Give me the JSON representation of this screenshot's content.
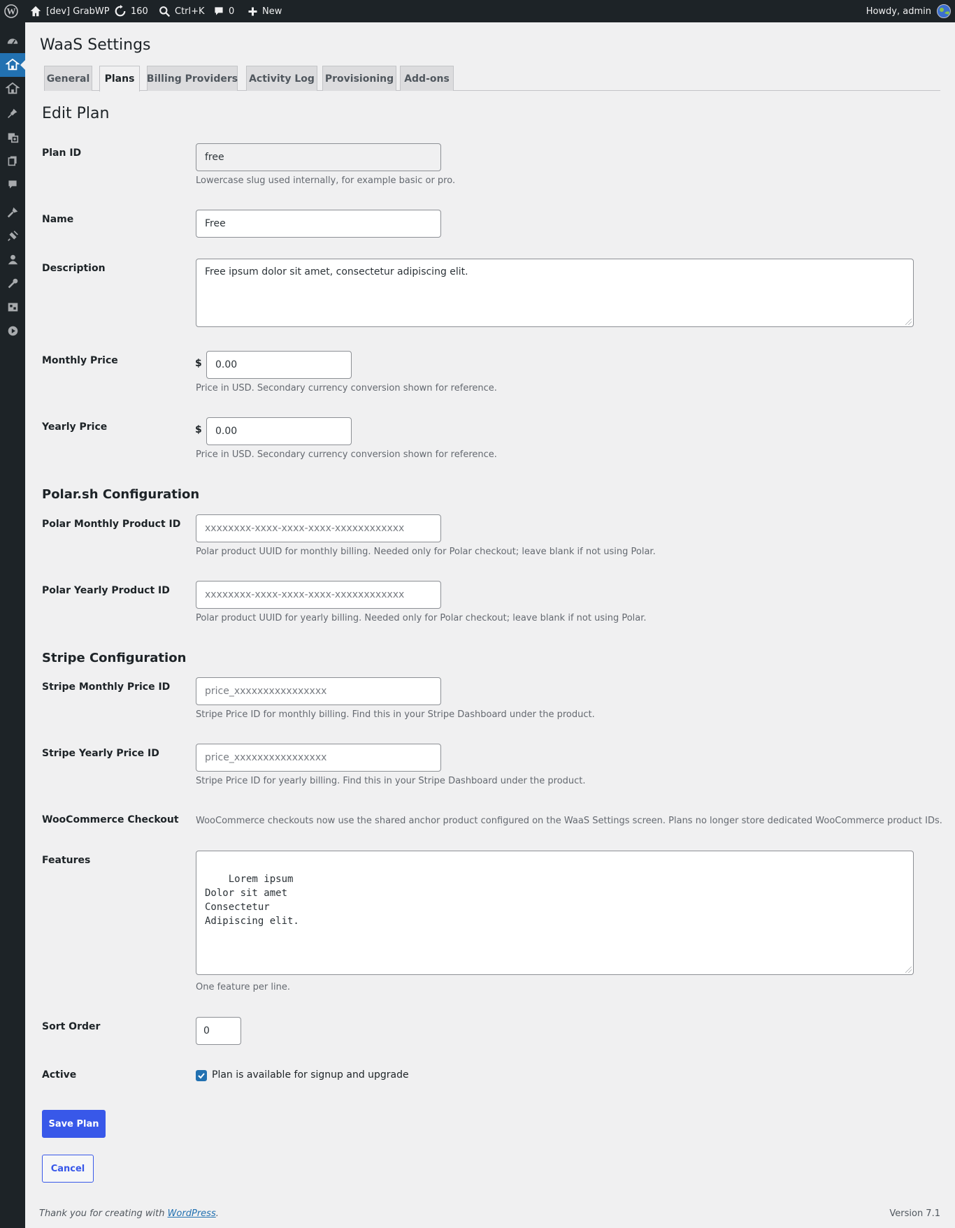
{
  "adminbar": {
    "site_name": "[dev] GrabWP",
    "updates_count": "160",
    "search_shortcut": "Ctrl+K",
    "comments_count": "0",
    "new_label": "New",
    "greeting": "Howdy, admin"
  },
  "sidemenu": {
    "icons": [
      "dashboard-icon",
      "waas-icon",
      "sites-icon",
      "posts-icon",
      "media-icon",
      "pages-icon",
      "comments-icon",
      "appearance-icon",
      "plugins-icon",
      "users-icon",
      "tools-icon",
      "settings-icon",
      "player-icon"
    ]
  },
  "page": {
    "title": "WaaS Settings",
    "tabs": [
      {
        "label": "General",
        "active": false
      },
      {
        "label": "Plans",
        "active": true
      },
      {
        "label": "Billing Providers",
        "active": false
      },
      {
        "label": "Activity Log",
        "active": false
      },
      {
        "label": "Provisioning",
        "active": false
      },
      {
        "label": "Add-ons",
        "active": false
      }
    ],
    "heading": "Edit Plan"
  },
  "form": {
    "plan_id": {
      "label": "Plan ID",
      "value": "free",
      "help": "Lowercase slug used internally, for example basic or pro."
    },
    "name": {
      "label": "Name",
      "value": "Free"
    },
    "description": {
      "label": "Description",
      "value": "Free ipsum dolor sit amet, consectetur adipiscing elit."
    },
    "monthly_price": {
      "label": "Monthly Price",
      "currency": "$",
      "value": "0.00",
      "help": "Price in USD. Secondary currency conversion shown for reference."
    },
    "yearly_price": {
      "label": "Yearly Price",
      "currency": "$",
      "value": "0.00",
      "help": "Price in USD. Secondary currency conversion shown for reference."
    },
    "polar": {
      "title": "Polar.sh Configuration",
      "monthly": {
        "label": "Polar Monthly Product ID",
        "placeholder": "xxxxxxxx-xxxx-xxxx-xxxx-xxxxxxxxxxxx",
        "help": "Polar product UUID for monthly billing. Needed only for Polar checkout; leave blank if not using Polar."
      },
      "yearly": {
        "label": "Polar Yearly Product ID",
        "placeholder": "xxxxxxxx-xxxx-xxxx-xxxx-xxxxxxxxxxxx",
        "help": "Polar product UUID for yearly billing. Needed only for Polar checkout; leave blank if not using Polar."
      }
    },
    "stripe": {
      "title": "Stripe Configuration",
      "monthly": {
        "label": "Stripe Monthly Price ID",
        "placeholder": "price_xxxxxxxxxxxxxxxx",
        "help": "Stripe Price ID for monthly billing. Find this in your Stripe Dashboard under the product."
      },
      "yearly": {
        "label": "Stripe Yearly Price ID",
        "placeholder": "price_xxxxxxxxxxxxxxxx",
        "help": "Stripe Price ID for yearly billing. Find this in your Stripe Dashboard under the product."
      }
    },
    "woocommerce": {
      "label": "WooCommerce Checkout",
      "text": "WooCommerce checkouts now use the shared anchor product configured on the WaaS Settings screen. Plans no longer store dedicated WooCommerce product IDs."
    },
    "features": {
      "label": "Features",
      "value": "Lorem ipsum\nDolor sit amet\nConsectetur\nAdipiscing elit.",
      "help": "One feature per line."
    },
    "sort_order": {
      "label": "Sort Order",
      "value": "0"
    },
    "active": {
      "label": "Active",
      "checked": true,
      "checkbox_label": "Plan is available for signup and upgrade"
    },
    "save_label": "Save Plan",
    "cancel_label": "Cancel"
  },
  "footer": {
    "thanks_prefix": "Thank you for creating with ",
    "thanks_link": "WordPress",
    "thanks_suffix": ".",
    "version": "Version 7.1"
  },
  "colors": {
    "adminbar_bg": "#1d2327",
    "accent": "#3858e9",
    "menu_current": "#2271b1",
    "page_bg": "#f0f0f1"
  }
}
